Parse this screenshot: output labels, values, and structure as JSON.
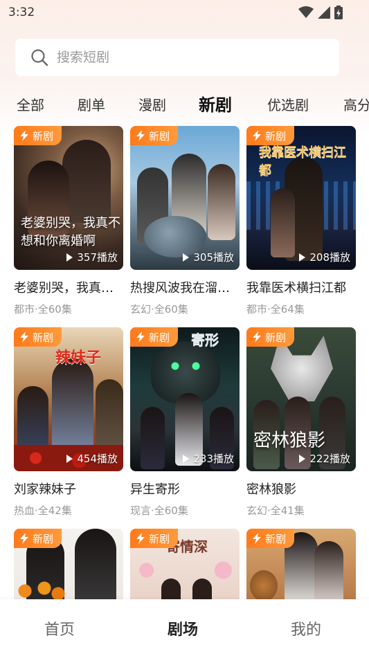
{
  "status_bar": {
    "time": "3:32"
  },
  "search": {
    "placeholder": "搜索短剧"
  },
  "tabs": [
    {
      "label": "全部"
    },
    {
      "label": "剧单"
    },
    {
      "label": "漫剧"
    },
    {
      "label": "新剧",
      "active": true
    },
    {
      "label": "优选剧"
    },
    {
      "label": "高分"
    }
  ],
  "badge_label": "新剧",
  "cards": [
    {
      "title": "老婆别哭，我真…",
      "meta": "都市·全60集",
      "plays": "357播放",
      "poster_text": "老婆别哭，我真不想和你离婚啊"
    },
    {
      "title": "热搜风波我在溜…",
      "meta": "玄幻·全60集",
      "plays": "305播放",
      "poster_text": ""
    },
    {
      "title": "我靠医术横扫江都",
      "meta": "都市·全64集",
      "plays": "208播放",
      "poster_text": "我靠医术横扫江都"
    },
    {
      "title": "刘家辣妹子",
      "meta": "热血·全42集",
      "plays": "454播放",
      "poster_text": "辣妹子"
    },
    {
      "title": "异生寄形",
      "meta": "现言·全60集",
      "plays": "233播放",
      "poster_text": "寄形"
    },
    {
      "title": "密林狼影",
      "meta": "玄幻·全41集",
      "plays": "222播放",
      "poster_text": "密林狼影"
    },
    {
      "title": "",
      "meta": "",
      "plays": "",
      "poster_text": ""
    },
    {
      "title": "",
      "meta": "",
      "plays": "",
      "poster_text": "寄情深"
    },
    {
      "title": "",
      "meta": "",
      "plays": "",
      "poster_text": ""
    }
  ],
  "bottom_nav": [
    {
      "label": "首页"
    },
    {
      "label": "剧场",
      "active": true
    },
    {
      "label": "我的"
    }
  ],
  "colors": {
    "badge": "#ff7a1a",
    "background_top": "#fdeee8"
  }
}
